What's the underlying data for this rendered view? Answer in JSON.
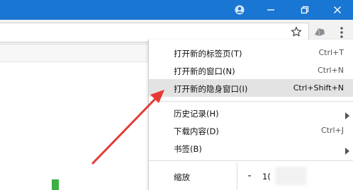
{
  "title_bar": {
    "icons": [
      "account-icon",
      "minimize-icon",
      "restore-icon",
      "close-icon"
    ],
    "color": "#1976d2"
  },
  "toolbar": {
    "icons": [
      "bookmark-star-icon",
      "extension-icon",
      "more-menu-icon"
    ]
  },
  "menu": {
    "items": [
      {
        "label": "打开新的标签页(T)",
        "shortcut": "Ctrl+T"
      },
      {
        "label": "打开新的窗口(N)",
        "shortcut": "Ctrl+N"
      },
      {
        "label": "打开新的隐身窗口(I)",
        "shortcut": "Ctrl+Shift+N",
        "highlighted": true
      },
      {
        "label": "历史记录(H)",
        "submenu": true
      },
      {
        "label": "下载内容(D)",
        "shortcut": "Ctrl+J"
      },
      {
        "label": "书签(B)",
        "submenu": true
      }
    ],
    "zoom": {
      "label": "缩放",
      "minus": "-",
      "value": "1("
    }
  },
  "annotation": {
    "arrow_color": "#e53935"
  }
}
